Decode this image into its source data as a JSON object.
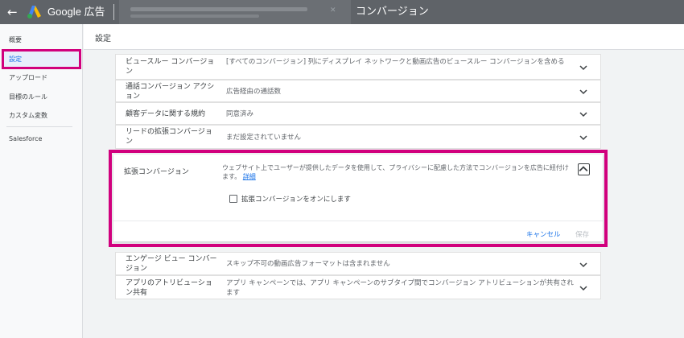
{
  "topbar": {
    "back_icon": "arrow-left-icon",
    "brand": "Google 広告",
    "title": "コンバージョン",
    "logo_colors": [
      "#fbbc04",
      "#4285f4",
      "#34a853"
    ]
  },
  "sidebar": {
    "items": [
      {
        "label": "概要"
      },
      {
        "label": "設定"
      },
      {
        "label": "アップロード"
      },
      {
        "label": "目標のルール"
      },
      {
        "label": "カスタム変数"
      },
      {
        "label": "Salesforce"
      }
    ],
    "highlight_color": "#d1007d"
  },
  "header": {
    "title": "設定"
  },
  "rows_top": [
    {
      "label": "ビュースルー コンバージョン",
      "value": "[すべてのコンバージョン] 列にディスプレイ ネットワークと動画広告のビュースルー コンバージョンを含める"
    },
    {
      "label": "通話コンバージョン アクション",
      "value": "広告経由の通話数"
    },
    {
      "label": "顧客データに関する規約",
      "value": "同意済み"
    },
    {
      "label": "リードの拡張コンバージョン",
      "value": "まだ設定されていません"
    }
  ],
  "expanded": {
    "label": "拡張コンバージョン",
    "description": "ウェブサイト上でユーザーが提供したデータを使用して、プライバシーに配慮した方法でコンバージョンを広告に紐付けます。",
    "link": "詳細",
    "checkbox_label": "拡張コンバージョンをオンにします",
    "cancel": "キャンセル",
    "save": "保存"
  },
  "rows_bottom": [
    {
      "label": "エンゲージ ビュー コンバージョン",
      "value": "スキップ不可の動画広告フォーマットは含まれません"
    },
    {
      "label": "アプリのアトリビューション共有",
      "value": "アプリ キャンペーンでは、アプリ キャンペーンのサブタイプ間でコンバージョン アトリビューションが共有されます"
    }
  ]
}
